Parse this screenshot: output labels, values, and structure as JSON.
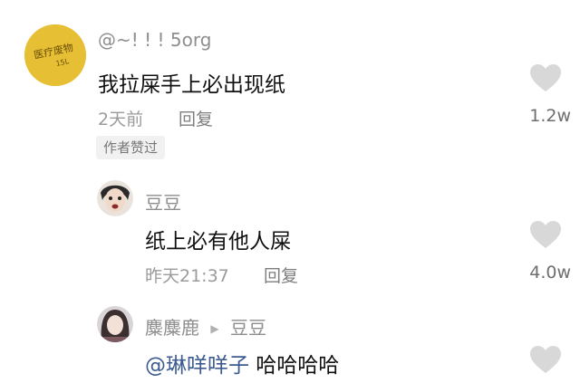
{
  "comment1": {
    "username": "@~! ! ! 5org",
    "avatar_text": "医疗废物",
    "avatar_subtext": "15L",
    "text": "我拉屎手上必出现纸",
    "time": "2天前",
    "reply_label": "回复",
    "likes": "1.2w",
    "badge": "作者赞过"
  },
  "reply1": {
    "username": "豆豆",
    "text": "纸上必有他人屎",
    "time": "昨天21:37",
    "reply_label": "回复",
    "likes": "4.0w"
  },
  "reply2": {
    "username": "麋麋鹿",
    "arrow": "▶",
    "reply_to": "豆豆",
    "mention": "@琳咩咩子",
    "text": " 哈哈哈哈"
  },
  "colors": {
    "avatar_gold": "#e6bf34",
    "heart_gray": "#d8d8d8",
    "mention_blue": "#3c5b91"
  }
}
